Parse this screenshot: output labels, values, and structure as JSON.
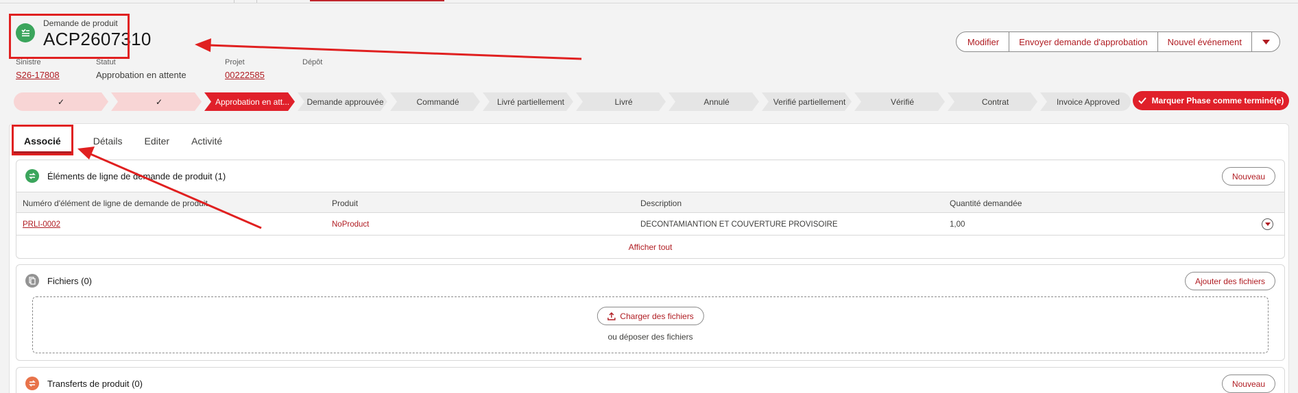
{
  "record": {
    "type_label": "Demande de produit",
    "name": "ACP2607310"
  },
  "actions": {
    "modify": "Modifier",
    "send_approval": "Envoyer demande d'approbation",
    "new_event": "Nouvel événement"
  },
  "fields": [
    {
      "label": "Sinistre",
      "value": "S26-17808"
    },
    {
      "label": "Statut",
      "value": "Approbation en attente"
    },
    {
      "label": "Projet",
      "value": "00222585"
    },
    {
      "label": "Dépôt",
      "value": ""
    }
  ],
  "path": {
    "stages": [
      {
        "label": "✓",
        "state": "done"
      },
      {
        "label": "✓",
        "state": "done"
      },
      {
        "label": "Approbation en att...",
        "state": "current"
      },
      {
        "label": "Demande approuvée",
        "state": "todo"
      },
      {
        "label": "Commandé",
        "state": "todo"
      },
      {
        "label": "Livré partiellement",
        "state": "todo"
      },
      {
        "label": "Livré",
        "state": "todo"
      },
      {
        "label": "Annulé",
        "state": "todo"
      },
      {
        "label": "Verifié partiellement",
        "state": "todo"
      },
      {
        "label": "Vérifié",
        "state": "todo"
      },
      {
        "label": "Contrat",
        "state": "todo"
      },
      {
        "label": "Invoice Approved",
        "state": "todo"
      }
    ],
    "mark_complete": "Marquer Phase comme terminé(e)"
  },
  "tabs": [
    "Associé",
    "Détails",
    "Editer",
    "Activité"
  ],
  "related": {
    "line_items": {
      "title": "Éléments de ligne de demande de produit (1)",
      "new_button": "Nouveau",
      "columns": [
        "Numéro d'élément de ligne de demande de produit",
        "Produit",
        "Description",
        "Quantité demandée"
      ],
      "rows": [
        {
          "number": "PRLI-0002",
          "product": "NoProduct",
          "description": "DECONTAMIANTION ET COUVERTURE PROVISOIRE",
          "quantity": "1,00"
        }
      ],
      "view_all": "Afficher tout"
    },
    "files": {
      "title": "Fichiers (0)",
      "add_button": "Ajouter des fichiers",
      "upload_button": "Charger des fichiers",
      "drop_text": "ou déposer des fichiers"
    },
    "transfers": {
      "title": "Transferts de produit (0)",
      "new_button": "Nouveau"
    }
  },
  "colors": {
    "brand": "#b01c22",
    "accent_red": "#e0202a",
    "done_stage": "#f8d5d5",
    "annotation": "#e02020",
    "green_icon": "#3ba55c",
    "files_icon": "#939393",
    "transfer_icon": "#e8734a"
  }
}
